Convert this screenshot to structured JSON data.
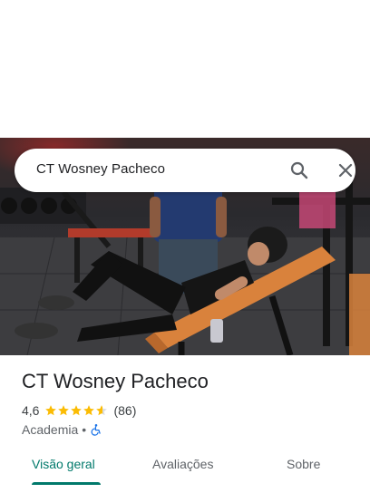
{
  "search": {
    "query": "CT Wosney Pacheco",
    "search_icon": "search-icon",
    "close_icon": "close-icon"
  },
  "place": {
    "title": "CT Wosney Pacheco",
    "rating": "4,6",
    "rating_value": 4.6,
    "max_stars": 5,
    "review_count": "(86)",
    "category": "Academia",
    "separator": "•",
    "accessibility_icon": "wheelchair-icon"
  },
  "tabs": [
    {
      "label": "Visão geral",
      "active": true
    },
    {
      "label": "Avaliações",
      "active": false
    },
    {
      "label": "Sobre",
      "active": false
    }
  ],
  "colors": {
    "accent": "#00796b",
    "star": "#fbbc04",
    "wheelchair": "#1a73e8"
  }
}
